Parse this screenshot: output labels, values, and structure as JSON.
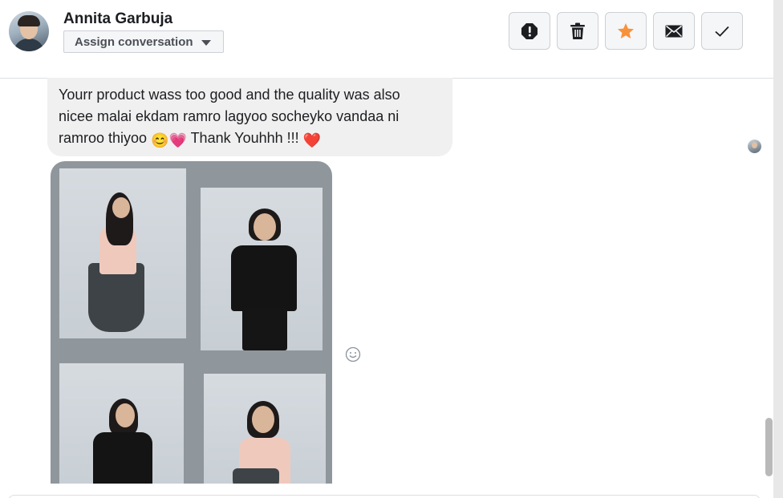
{
  "header": {
    "contact_name": "Annita Garbuja",
    "assign_label": "Assign conversation"
  },
  "actions": [
    {
      "icon": "alert-icon",
      "color": "#1c1e21"
    },
    {
      "icon": "trash-icon",
      "color": "#1c1e21"
    },
    {
      "icon": "star-icon",
      "color": "#f7923b"
    },
    {
      "icon": "mail-icon",
      "color": "#1c1e21"
    },
    {
      "icon": "check-icon",
      "color": "#1c1e21"
    }
  ],
  "message": {
    "line1": "Yourr product wass too good and the quality was also",
    "line2": "nicee malai ekdam ramro lagyoo socheyko vandaa ni",
    "line3_text": "ramroo thiyoo ",
    "line3_emoji": "😊💗",
    "line3_tail": " Thank Youhhh !!! ",
    "line3_heart": "❤️",
    "bubble_color": "#f1f0f0"
  },
  "attachment": {
    "type": "image",
    "description_icon": "photo-collage"
  },
  "reaction": {
    "icon": "smiley-icon"
  }
}
